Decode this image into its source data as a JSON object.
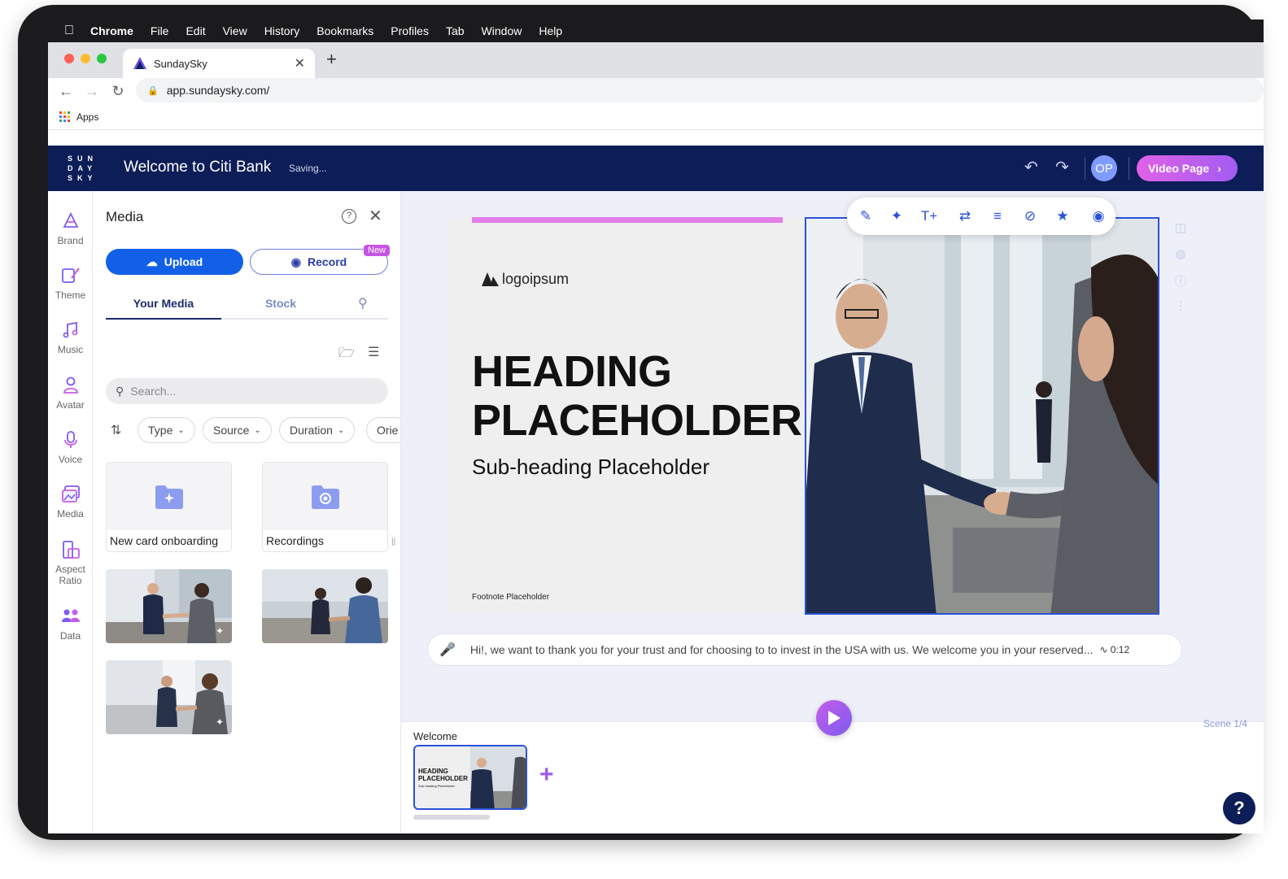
{
  "menubar": {
    "app": "Chrome",
    "items": [
      "File",
      "Edit",
      "View",
      "History",
      "Bookmarks",
      "Profiles",
      "Tab",
      "Window",
      "Help"
    ]
  },
  "browser": {
    "tab_title": "SundaySky",
    "url": "app.sundaysky.com/",
    "bookmark": "Apps"
  },
  "header": {
    "logo": "SUNDAYSKY",
    "title": "Welcome to Citi Bank",
    "status": "Saving...",
    "avatar_initials": "OP",
    "video_page_label": "Video Page"
  },
  "rail": {
    "items": [
      {
        "label": "Brand",
        "icon": "brand-icon"
      },
      {
        "label": "Theme",
        "icon": "theme-icon"
      },
      {
        "label": "Music",
        "icon": "music-icon"
      },
      {
        "label": "Avatar",
        "icon": "avatar-icon"
      },
      {
        "label": "Voice",
        "icon": "microphone-icon"
      },
      {
        "label": "Media",
        "icon": "media-icon"
      },
      {
        "label": "Aspect Ratio",
        "icon": "aspect-ratio-icon"
      },
      {
        "label": "Data",
        "icon": "data-icon"
      }
    ]
  },
  "media_panel": {
    "title": "Media",
    "upload_label": "Upload",
    "record_label": "Record",
    "new_badge": "New",
    "tabs": {
      "your_media": "Your Media",
      "stock": "Stock"
    },
    "search_placeholder": "Search...",
    "filters": [
      "Type",
      "Source",
      "Duration",
      "Orie"
    ],
    "folders": [
      {
        "label": "New card onboarding",
        "icon": "sparkle-folder-icon"
      },
      {
        "label": "Recordings",
        "icon": "record-folder-icon"
      }
    ]
  },
  "slide": {
    "brand": "logoipsum",
    "heading_line1": "HEADING",
    "heading_line2": "PLACEHOLDER",
    "subheading": "Sub-heading Placeholder",
    "footnote": "Footnote Placeholder"
  },
  "narration": {
    "text": "Hi!, we want to thank you for your trust and for choosing to to invest in the USA with us. We welcome you in your reserved...",
    "duration": "0:12"
  },
  "timeline": {
    "scene_counter": "Scene 1/4",
    "scene_name": "Welcome",
    "thumb_heading_line1": "HEADING",
    "thumb_heading_line2": "PLACEHOLDER",
    "thumb_sub": "Sub-heading Placeholder"
  },
  "colors": {
    "header_bg": "#0d1d57",
    "primary": "#1260e8",
    "accent_gradient_start": "#e061e6",
    "accent_gradient_end": "#a25cf2",
    "slide_bar": "#e37fe9"
  }
}
